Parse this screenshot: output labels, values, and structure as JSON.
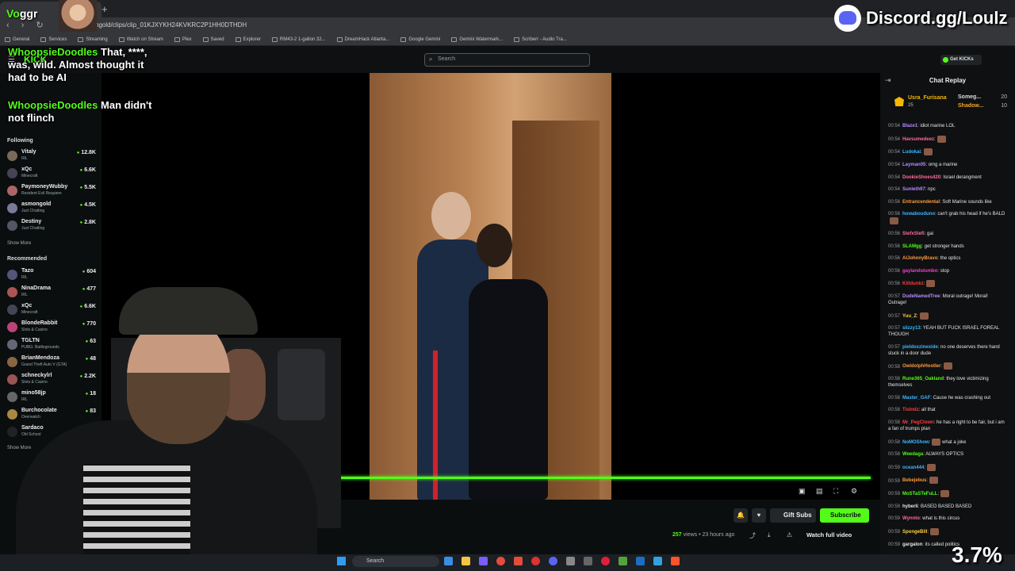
{
  "overlay": {
    "streamer_name_prefix": "Vo",
    "streamer_name_suffix": "ggr",
    "discord_text": "Discord.gg/Loulz",
    "percent": "3.7%"
  },
  "browser": {
    "url": "ngold/clips/clip_01KJXYKH24KVKRC2P1HH0DTHDH",
    "bookmarks": [
      "General",
      "Services",
      "Streaming",
      "Watch on Stream",
      "Plex",
      "Saved",
      "Explorer",
      "RM43-2 1-gallon 32...",
      "DreamHack Atlanta...",
      "Google Gemini",
      "Gemini Watermark...",
      "Scriberr - Audio Tra..."
    ]
  },
  "header": {
    "search_placeholder": "Search",
    "get_kicks": "Get KICKs",
    "logo_fragment": "KICK"
  },
  "chat_overlay": [
    {
      "user": "WhoopsieDoodles",
      "text": "That, ****, was, wild. Almost thought it had to be AI"
    },
    {
      "user": "WhoopsieDoodles",
      "text": "Man didn't not flinch"
    }
  ],
  "sidebar": {
    "following_title": "Following",
    "following": [
      {
        "name": "Vitaly",
        "category": "IRL",
        "viewers": "12.8K"
      },
      {
        "name": "xQc",
        "category": "Minecraft",
        "viewers": "6.6K"
      },
      {
        "name": "PaymoneyWubby",
        "category": "Resident Evil Requiem",
        "viewers": "5.5K"
      },
      {
        "name": "asmongold",
        "category": "Just Chatting",
        "viewers": "4.5K"
      },
      {
        "name": "Destiny",
        "category": "Just Chatting",
        "viewers": "2.8K"
      }
    ],
    "show_more": "Show More",
    "recommended_title": "Recommended",
    "recommended": [
      {
        "name": "Tazo",
        "category": "IRL",
        "viewers": "604"
      },
      {
        "name": "NinaDrama",
        "category": "IRL",
        "viewers": "477"
      },
      {
        "name": "xQc",
        "category": "Minecraft",
        "viewers": "6.6K"
      },
      {
        "name": "BlondeRabbit",
        "category": "Slots & Casino",
        "viewers": "770"
      },
      {
        "name": "TGLTN",
        "category": "PUBG: Battlegrounds",
        "viewers": "63"
      },
      {
        "name": "BrianMendoza",
        "category": "Grand Theft Auto V (GTA)",
        "viewers": "48"
      },
      {
        "name": "schneckylrl",
        "category": "Slots & Casino",
        "viewers": "2.2K"
      },
      {
        "name": "mino58jp",
        "category": "IRL",
        "viewers": "18"
      },
      {
        "name": "Burchocolate",
        "category": "Overwatch",
        "viewers": "83"
      },
      {
        "name": "Sardaco",
        "category": "Old School",
        "viewers": ""
      }
    ],
    "show_more_2": "Show More"
  },
  "video": {
    "views": "257",
    "views_label": "views",
    "age": "• 23 hours ago",
    "gift_subs": "Gift Subs",
    "subscribe": "Subscribe",
    "watch_full": "Watch full video"
  },
  "chat": {
    "title": "Chat Replay",
    "leaders": [
      {
        "name": "Usra_Furisana",
        "count": "25"
      },
      {
        "name": "Someg...",
        "count": "20"
      },
      {
        "name": "Shadow...",
        "count": "10"
      }
    ],
    "messages": [
      {
        "t": "00:54",
        "user": "Blaze1",
        "color": "#b58bff",
        "text": ": idiot marine LOL"
      },
      {
        "t": "00:54",
        "user": "Havsumedeez",
        "color": "#ff6b9a",
        "text": ":",
        "emote": true
      },
      {
        "t": "00:54",
        "user": "Ludokai",
        "color": "#3fb6ff",
        "text": ":",
        "emote": true
      },
      {
        "t": "00:54",
        "user": "Layman05",
        "color": "#b58bff",
        "text": ": omg a marine"
      },
      {
        "t": "00:54",
        "user": "DookieShoes420",
        "color": "#ff6b9a",
        "text": ": Israel derangment"
      },
      {
        "t": "00:54",
        "user": "Sunleth97",
        "color": "#b58bff",
        "text": ": npc"
      },
      {
        "t": "00:56",
        "user": "Entrancendental",
        "color": "#ff9a3c",
        "text": ": Soft Marine sounds like"
      },
      {
        "t": "00:56",
        "user": "howabouduno",
        "color": "#3fb6ff",
        "text": ": can't grab his head if he's BALD",
        "emote": true
      },
      {
        "t": "00:56",
        "user": "StefxStefi",
        "color": "#ff6b9a",
        "text": ": gai"
      },
      {
        "t": "00:56",
        "user": "SLAMgg",
        "color": "#53fc18",
        "text": ": get stronger hands"
      },
      {
        "t": "00:56",
        "user": "AlJohnnyBravo",
        "color": "#ff9a3c",
        "text": ": the optics"
      },
      {
        "t": "00:56",
        "user": "gaylandstumbo",
        "color": "#ff3cc8",
        "text": ": stop"
      },
      {
        "t": "00:56",
        "user": "Killdunkz",
        "color": "#ff3c3c",
        "text": ":",
        "emote": true
      },
      {
        "t": "00:57",
        "user": "DudeNamedTree",
        "color": "#b58bff",
        "text": ": Moral outrage! Moral! Outrage!"
      },
      {
        "t": "00:57",
        "user": "Yuu_Z",
        "color": "#ffd23c",
        "text": ":",
        "emote": true
      },
      {
        "t": "00:57",
        "user": "slizzy13",
        "color": "#3fb6ff",
        "text": ": YEAH BUT FUCK ISRAEL FOREAL THOUGH"
      },
      {
        "t": "00:57",
        "user": "pieldoxzinexide",
        "color": "#3fb6ff",
        "text": ": no one deserves there hand stuck in a door dude"
      },
      {
        "t": "00:58",
        "user": "OwldolphHootler",
        "color": "#ff9a3c",
        "text": ":",
        "emote": true
      },
      {
        "t": "00:58",
        "user": "Rune365_Oakland",
        "color": "#53fc18",
        "text": ": they love victimizing themselves"
      },
      {
        "t": "00:58",
        "user": "Master_GAF",
        "color": "#3fb6ff",
        "text": ": Cause he was crashing out"
      },
      {
        "t": "00:58",
        "user": "Tislndz",
        "color": "#ff3c3c",
        "text": ": all that"
      },
      {
        "t": "00:58",
        "user": "Mr_PegClown",
        "color": "#ff3c3c",
        "text": ": he has a right to be fair, but i am a fan of trumps plan"
      },
      {
        "t": "00:58",
        "user": "NoMOShow",
        "color": "#3fb6ff",
        "text": ":",
        "emote": true,
        "after": " what a joke"
      },
      {
        "t": "00:58",
        "user": "Weedaga",
        "color": "#53fc18",
        "text": ": ALWAYS OPTICS"
      },
      {
        "t": "00:59",
        "user": "ocean444",
        "color": "#3fb6ff",
        "text": ":",
        "emote": true
      },
      {
        "t": "00:59",
        "user": "Bebejebus",
        "color": "#ff9a3c",
        "text": ":",
        "emote": true
      },
      {
        "t": "00:59",
        "user": "MoSTaSTeFuLL",
        "color": "#53fc18",
        "text": ":",
        "emote": true
      },
      {
        "t": "00:59",
        "user": "hyberli",
        "color": "#e6e6e6",
        "text": ": BASED BASED BASED"
      },
      {
        "t": "00:59",
        "user": "Wynnto",
        "color": "#ff6b9a",
        "text": ": what is this circus"
      },
      {
        "t": "00:59",
        "user": "SpongeBill",
        "color": "#ffd23c",
        "text": ":",
        "emote": true
      },
      {
        "t": "00:59",
        "user": "gargalon",
        "color": "#e6e6e6",
        "text": ": its called politics"
      }
    ]
  },
  "taskbar": {
    "search_placeholder": "Search"
  },
  "brand_colors": {
    "kick_green": "#53fc18",
    "discord_blurple": "#5865f2"
  }
}
